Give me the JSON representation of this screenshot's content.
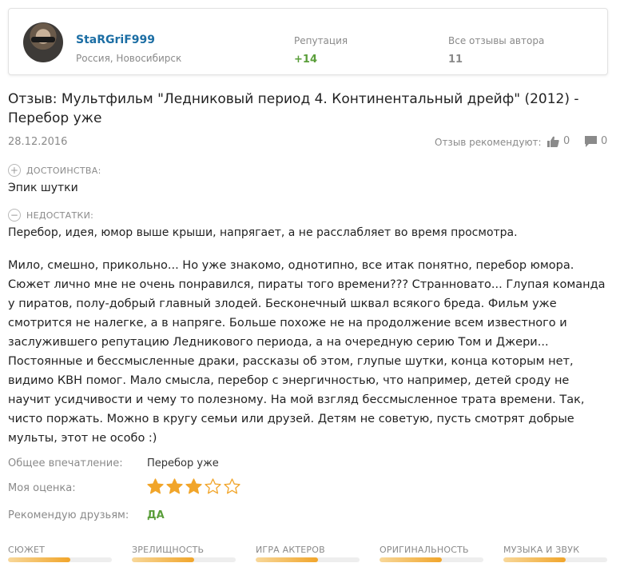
{
  "author": {
    "name": "StaRGriF999",
    "location": "Россия, Новосибирск",
    "reputation_label": "Репутация",
    "reputation_value": "+14",
    "reviews_label": "Все отзывы автора",
    "reviews_value": "11"
  },
  "review": {
    "title": "Отзыв: Мультфильм \"Ледниковый период 4. Континентальный дрейф\" (2012) - Перебор уже",
    "date": "28.12.2016",
    "recommend_label": "Отзыв рекомендуют:",
    "likes": "0",
    "comments": "0",
    "pros_label": "ДОСТОИНСТВА:",
    "pros": "Эпик шутки",
    "cons_label": "НЕДОСТАТКИ:",
    "cons": "Перебор, идея, юмор выше крыши, напрягает, а не расслабляет во время просмотра.",
    "body": "Мило, смешно, прикольно... Но уже знакомо, однотипно, все итак понятно, перебор юмора. Сюжет лично мне не очень понравился, пираты того времени??? Странновато... Глупая команда у пиратов, полу-добрый главный злодей. Бесконечный шквал всякого бреда. Фильм уже смотрится не налегке, а в напряге. Больше похоже не на продолжение всем известного и заслужившего репутацию Ледникового периода, а на очередную серию Том и Джери... Постоянные и бессмысленные драки, рассказы об этом, глупые шутки, конца которым нет, видимо КВН помог. Мало смысла, перебор с энергичностью, что например, детей сроду не научит усидчивости и чему то полезному. На мой взгляд бессмысленное трата времени. Так, чисто поржать. Можно в кругу семьи или друзей. Детям не советую, пусть смотрят добрые мульты, этот не особо :)",
    "impression_label": "Общее впечатление:",
    "impression": "Перебор уже",
    "rating_label": "Моя оценка:",
    "rating": 3,
    "rating_max": 5,
    "friends_label": "Рекомендую друзьям:",
    "friends": "ДА"
  },
  "criteria": [
    {
      "label": "СЮЖЕТ",
      "fill": 0.6
    },
    {
      "label": "ЗРЕЛИЩНОСТЬ",
      "fill": 0.6
    },
    {
      "label": "ИГРА АКТЕРОВ",
      "fill": 0.6
    },
    {
      "label": "ОРИГИНАЛЬНОСТЬ",
      "fill": 0.6
    },
    {
      "label": "МУЗЫКА И ЗВУК",
      "fill": 0.6
    }
  ],
  "colors": {
    "accent_green": "#5a9e3a",
    "name_blue": "#1c6ea4",
    "star_gold": "#f1a52a"
  }
}
